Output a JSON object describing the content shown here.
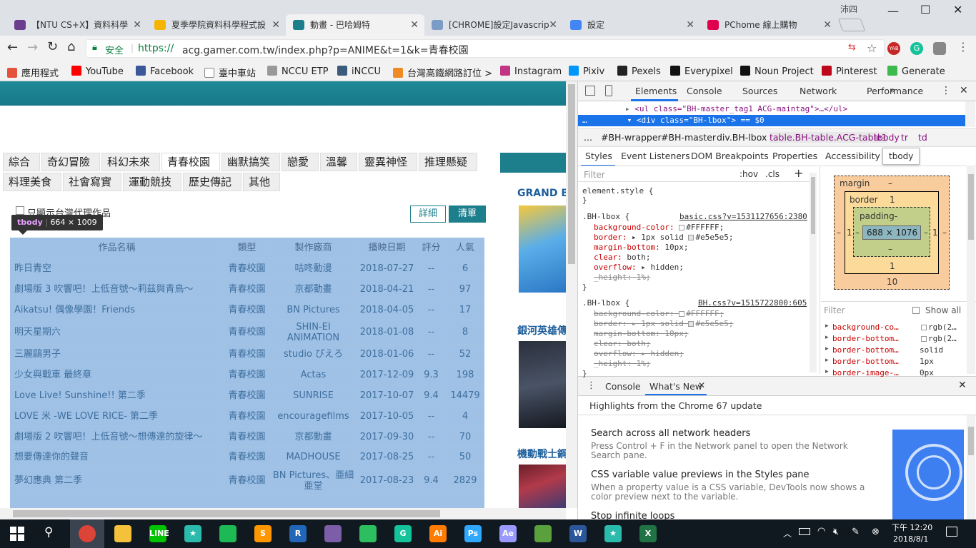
{
  "browser": {
    "tabs": [
      {
        "title": "【NTU CS+X】資料科學",
        "icon": "ntu-icon",
        "color": "#6a3d8f",
        "active": false
      },
      {
        "title": "夏季學院資料科學程式設",
        "icon": "slides-icon",
        "color": "#f4b400",
        "active": false
      },
      {
        "title": "動畫 - 巴哈姆特",
        "icon": "bahamut-icon",
        "color": "#1d7f8c",
        "active": true
      },
      {
        "title": "[CHROME]設定Javascrip",
        "icon": "ew-icon",
        "color": "#7a9cc6",
        "active": false
      },
      {
        "title": "設定",
        "icon": "settings-gear-icon",
        "color": "#4285f4",
        "active": false
      },
      {
        "title": "PChome 線上購物",
        "icon": "pchome-icon",
        "color": "#e0004d",
        "active": false
      }
    ],
    "profile_name": "沛四",
    "url_security": "安全",
    "url_scheme": "https://",
    "url_rest": "acg.gamer.com.tw/index.php?p=ANIME&t=1&k=青春校園",
    "bookmarks": [
      {
        "label": "應用程式",
        "icon": "apps-grid-icon",
        "color": "#e5533d"
      },
      {
        "label": "YouTube",
        "icon": "youtube-icon",
        "color": "#ff0000"
      },
      {
        "label": "Facebook",
        "icon": "facebook-icon",
        "color": "#3b5998"
      },
      {
        "label": "臺中車站",
        "icon": "page-icon",
        "color": "#ffffff"
      },
      {
        "label": "NCCU ETP",
        "icon": "nccu-icon",
        "color": "#999999"
      },
      {
        "label": "iNCCU",
        "icon": "inccu-icon",
        "color": "#3a5b7a"
      },
      {
        "label": "台灣高鐵網路訂位 >",
        "icon": "thsr-icon",
        "color": "#f08a24"
      },
      {
        "label": "Instagram",
        "icon": "instagram-icon",
        "color": "#c13584"
      },
      {
        "label": "Pixiv",
        "icon": "pixiv-icon",
        "color": "#0096fa"
      },
      {
        "label": "Pexels",
        "icon": "pexels-icon",
        "color": "#222222"
      },
      {
        "label": "Everypixel",
        "icon": "everypixel-icon",
        "color": "#111111"
      },
      {
        "label": "Noun Project",
        "icon": "noun-project-icon",
        "color": "#111111"
      },
      {
        "label": "Pinterest",
        "icon": "pinterest-icon",
        "color": "#bd081c"
      },
      {
        "label": "Generate",
        "icon": "generate-icon",
        "color": "#3dba4e"
      }
    ]
  },
  "page": {
    "categories_row1": [
      "綜合",
      "奇幻冒險",
      "科幻未來",
      "青春校園",
      "幽默搞笑",
      "戀愛",
      "溫馨",
      "靈異神怪",
      "推理懸疑"
    ],
    "categories_row2": [
      "料理美食",
      "社會寫實",
      "運動競技",
      "歷史傳記",
      "其他"
    ],
    "active_category": "青春校園",
    "taiwan_only_label": "只顯示台灣代理作品",
    "detail_button": "詳細",
    "list_button": "清單",
    "inspect_tooltip": {
      "tag": "tbody",
      "size": "664 × 1009"
    },
    "sidebar_titles": [
      "GRAND B",
      "銀河英雄傳",
      "機動戰士鋼"
    ],
    "table": {
      "headers": [
        "作品名稱",
        "類型",
        "製作廠商",
        "播映日期",
        "評分",
        "人氣"
      ],
      "rows": [
        [
          "昨日青空",
          "青春校園",
          "咕咚動漫",
          "2018-07-27",
          "--",
          "6"
        ],
        [
          "劇場版 3 吹響吧！上低音號～莉茲與青鳥～",
          "青春校園",
          "京都動畫",
          "2018-04-21",
          "--",
          "97"
        ],
        [
          "Aikatsu! 偶像學園！Friends",
          "青春校園",
          "BN Pictures",
          "2018-04-05",
          "--",
          "17"
        ],
        [
          "明天星期六",
          "青春校園",
          "SHIN-EI ANIMATION",
          "2018-01-08",
          "--",
          "8"
        ],
        [
          "三麗鷗男子",
          "青春校園",
          "studio ぴえろ",
          "2018-01-06",
          "--",
          "52"
        ],
        [
          "少女與戰車 最終章",
          "青春校園",
          "Actas",
          "2017-12-09",
          "9.3",
          "198"
        ],
        [
          "Love Live! Sunshine!! 第二季",
          "青春校園",
          "SUNRISE",
          "2017-10-07",
          "9.4",
          "14479"
        ],
        [
          "LOVE 米 -WE LOVE RICE- 第二季",
          "青春校園",
          "encouragefilms",
          "2017-10-05",
          "--",
          "4"
        ],
        [
          "劇場版 2 吹響吧！上低音號～想傳達的旋律～",
          "青春校園",
          "京都動畫",
          "2017-09-30",
          "--",
          "70"
        ],
        [
          "想要傳達你的聲音",
          "青春校園",
          "MADHOUSE",
          "2017-08-25",
          "--",
          "50"
        ],
        [
          "夢幻應典 第二季",
          "青春校園",
          "BN Pictures、亜細亜堂",
          "2017-08-23",
          "9.4",
          "2829"
        ]
      ]
    }
  },
  "devtools": {
    "tabs": [
      "Elements",
      "Console",
      "Sources",
      "Network",
      "Performance"
    ],
    "more_tabs": "»",
    "dom_line1": "<ul class=\"BH-master_tag1 ACG-maintag\">…</ul>",
    "dom_line2": "<div class=\"BH-lbox\"> == $0",
    "breadcrumbs": [
      "...",
      "#BH-wrapper",
      "#BH-master",
      "div.BH-lbox",
      "table.BH-table.ACG-table1",
      "tbody",
      "tr",
      "td"
    ],
    "subtabs": [
      "Styles",
      "Event Listeners",
      "DOM Breakpoints",
      "Properties",
      "Accessibility"
    ],
    "tooltip_tbody": "tbody",
    "filter_placeholder": "Filter",
    "hov": ":hov",
    "cls": ".cls",
    "element_style": "element.style {",
    "rule1": {
      "selector": ".BH-lbox {",
      "source": "basic.css?v=1531127656:2380",
      "lines": [
        {
          "prop": "background-color:",
          "val": "#FFFFFF;",
          "swatch": "#FFFFFF"
        },
        {
          "prop": "border:",
          "val": "▸ 1px solid ",
          "val2": "#e5e5e5;",
          "swatch": "#e5e5e5"
        },
        {
          "prop": "margin-bottom:",
          "val": "10px;"
        },
        {
          "prop": "clear:",
          "val": "both;"
        },
        {
          "prop": "overflow:",
          "val": "▸ hidden;"
        },
        {
          "prop": "_height:",
          "val": "1%;",
          "strike": true
        }
      ]
    },
    "rule2": {
      "selector": ".BH-lbox {",
      "source": "BH.css?v=1515722800:605",
      "lines": [
        {
          "prop": "background-color:",
          "val": "#FFFFFF;",
          "swatch": "#FFFFFF"
        },
        {
          "prop": "border:",
          "val": "▸ 1px solid ",
          "val2": "#e5e5e5;",
          "swatch": "#e5e5e5"
        },
        {
          "prop": "margin-bottom:",
          "val": "10px;"
        },
        {
          "prop": "clear:",
          "val": "both;"
        },
        {
          "prop": "overflow:",
          "val": "▸ hidden;"
        },
        {
          "prop": "_height:",
          "val": "1%;"
        }
      ]
    },
    "boxmodel": {
      "margin": "margin",
      "margin_top": "–",
      "margin_left": "–",
      "margin_right": "–",
      "margin_bottom": "10",
      "border": "border",
      "border_top": "1",
      "border_left": "1",
      "border_right": "1",
      "border_bottom": "1",
      "padding": "padding-",
      "padding_bottom": "–",
      "padding_left": "–",
      "padding_right": "–",
      "content": "688 × 1076"
    },
    "computed_filter": "Filter",
    "show_all": "Show all",
    "computed": [
      {
        "prop": "background-co…",
        "val": "rgb(2…",
        "swatch": true
      },
      {
        "prop": "border-bottom…",
        "val": "rgb(2…",
        "swatch": true
      },
      {
        "prop": "border-bottom…",
        "val": "solid"
      },
      {
        "prop": "border-bottom…",
        "val": "1px"
      },
      {
        "prop": "border-image-…",
        "val": "0px"
      }
    ],
    "drawer_tabs": [
      "Console",
      "What's New"
    ],
    "drawer_header": "Highlights from the Chrome 67 update",
    "news": [
      {
        "title": "Search across all network headers",
        "body": "Press Control + F in the Network panel to open the Network Search pane."
      },
      {
        "title": "CSS variable value previews in the Styles pane",
        "body": "When a property value is a CSS variable, DevTools now shows a color preview next to the variable."
      },
      {
        "title": "Stop infinite loops",
        "body": ""
      }
    ]
  },
  "taskbar": {
    "time": "下午 12:20",
    "date": "2018/8/1",
    "apps": [
      {
        "name": "chrome-icon",
        "color": "#db4437",
        "label": ""
      },
      {
        "name": "file-explorer-icon",
        "color": "#f3c13a",
        "label": ""
      },
      {
        "name": "line-icon",
        "color": "#00c300",
        "label": "LINE"
      },
      {
        "name": "app-star-icon",
        "color": "#2bbbad",
        "label": "★"
      },
      {
        "name": "spotify-icon",
        "color": "#1db954",
        "label": ""
      },
      {
        "name": "sublime-icon",
        "color": "#ff9800",
        "label": "S"
      },
      {
        "name": "r-icon",
        "color": "#2266b8",
        "label": "R"
      },
      {
        "name": "cat-app-icon",
        "color": "#7b5ea7",
        "label": ""
      },
      {
        "name": "evernote-icon",
        "color": "#2dbe60",
        "label": ""
      },
      {
        "name": "grammarly-icon",
        "color": "#15c39a",
        "label": "G"
      },
      {
        "name": "illustrator-icon",
        "color": "#ff7c00",
        "label": "Ai"
      },
      {
        "name": "photoshop-icon",
        "color": "#31a8ff",
        "label": "Ps"
      },
      {
        "name": "after-effects-icon",
        "color": "#9999ff",
        "label": "Ae"
      },
      {
        "name": "maps-icon",
        "color": "#5aa03c",
        "label": ""
      },
      {
        "name": "word-icon",
        "color": "#2b579a",
        "label": "W"
      },
      {
        "name": "app-star2-icon",
        "color": "#2bbbad",
        "label": "★"
      },
      {
        "name": "excel-icon",
        "color": "#217346",
        "label": "X"
      }
    ]
  }
}
